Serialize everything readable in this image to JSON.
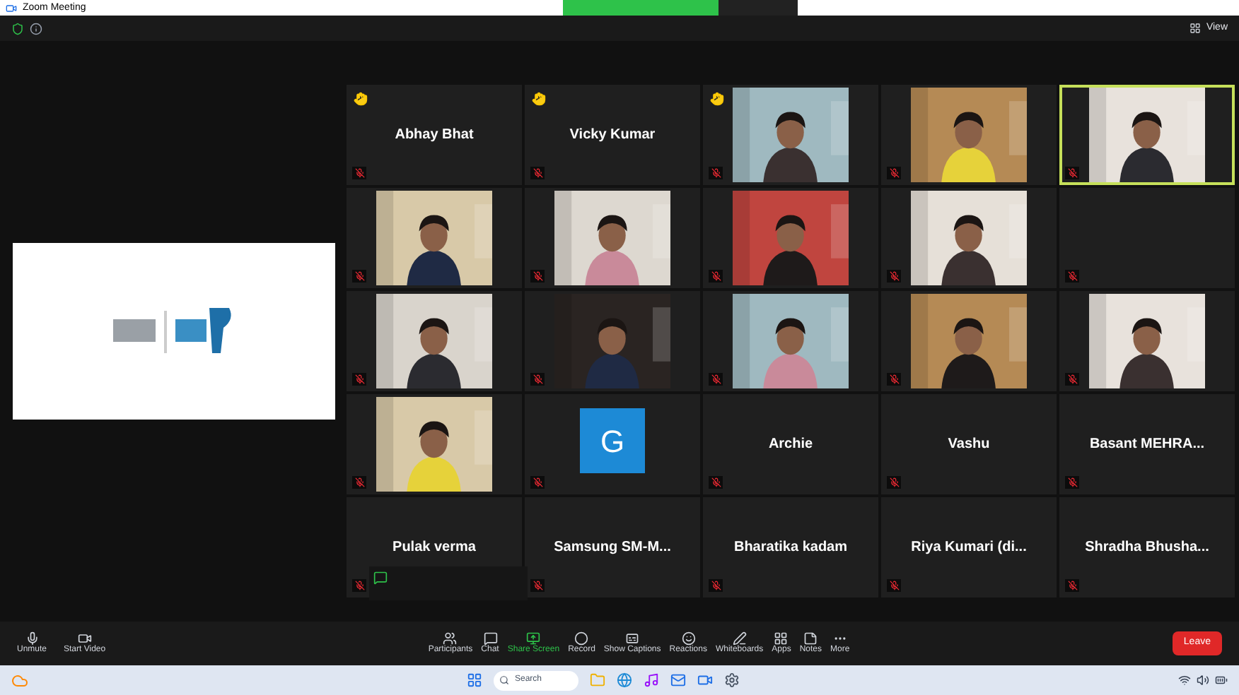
{
  "window": {
    "title": "Zoom Meeting"
  },
  "top_bar": {
    "view_label": "View"
  },
  "tiles": [
    {
      "kind": "name",
      "name": "Abhay Bhat",
      "hand_raised": true,
      "speaking": false
    },
    {
      "kind": "name",
      "name": "Vicky Kumar",
      "hand_raised": true,
      "speaking": false
    },
    {
      "kind": "video",
      "hand_raised": true,
      "speaking": false
    },
    {
      "kind": "video",
      "hand_raised": false,
      "speaking": false
    },
    {
      "kind": "video",
      "hand_raised": false,
      "speaking": true
    },
    {
      "kind": "video",
      "hand_raised": false,
      "speaking": false
    },
    {
      "kind": "video",
      "hand_raised": false,
      "speaking": false
    },
    {
      "kind": "video",
      "hand_raised": false,
      "speaking": false
    },
    {
      "kind": "video",
      "hand_raised": false,
      "speaking": false
    },
    {
      "kind": "blank",
      "hand_raised": false,
      "speaking": false
    },
    {
      "kind": "video",
      "hand_raised": false,
      "speaking": false
    },
    {
      "kind": "video",
      "hand_raised": false,
      "speaking": false
    },
    {
      "kind": "video",
      "hand_raised": false,
      "speaking": false
    },
    {
      "kind": "video",
      "hand_raised": false,
      "speaking": false
    },
    {
      "kind": "video",
      "hand_raised": false,
      "speaking": false
    },
    {
      "kind": "video",
      "hand_raised": false,
      "speaking": false
    },
    {
      "kind": "avatar",
      "initial": "G",
      "hand_raised": false,
      "speaking": false
    },
    {
      "kind": "name",
      "name": "Archie",
      "hand_raised": false,
      "speaking": false
    },
    {
      "kind": "name",
      "name": "Vashu",
      "hand_raised": false,
      "speaking": false
    },
    {
      "kind": "name",
      "name": "Basant MEHRA...",
      "hand_raised": false,
      "speaking": false
    },
    {
      "kind": "name",
      "name": "Pulak verma",
      "hand_raised": false,
      "speaking": false
    },
    {
      "kind": "name",
      "name": "Samsung SM-M...",
      "hand_raised": false,
      "speaking": false
    },
    {
      "kind": "name",
      "name": "Bharatika kadam",
      "hand_raised": false,
      "speaking": false
    },
    {
      "kind": "name",
      "name": "Riya Kumari (di...",
      "hand_raised": false,
      "speaking": false
    },
    {
      "kind": "name",
      "name": "Shradha Bhusha...",
      "hand_raised": false,
      "speaking": false
    }
  ],
  "toolbar": {
    "left": [
      {
        "label": "Unmute"
      },
      {
        "label": "Start Video"
      }
    ],
    "center": [
      {
        "label": "Participants",
        "selected": false
      },
      {
        "label": "Chat",
        "selected": false
      },
      {
        "label": "Share Screen",
        "selected": true
      },
      {
        "label": "Record",
        "selected": false
      },
      {
        "label": "Show Captions",
        "selected": false
      },
      {
        "label": "Reactions",
        "selected": false
      },
      {
        "label": "Whiteboards",
        "selected": false
      },
      {
        "label": "Apps",
        "selected": false
      },
      {
        "label": "Notes",
        "selected": false
      },
      {
        "label": "More",
        "selected": false
      }
    ],
    "leave_button": "Leave"
  },
  "taskbar": {
    "search_placeholder": "Search"
  }
}
